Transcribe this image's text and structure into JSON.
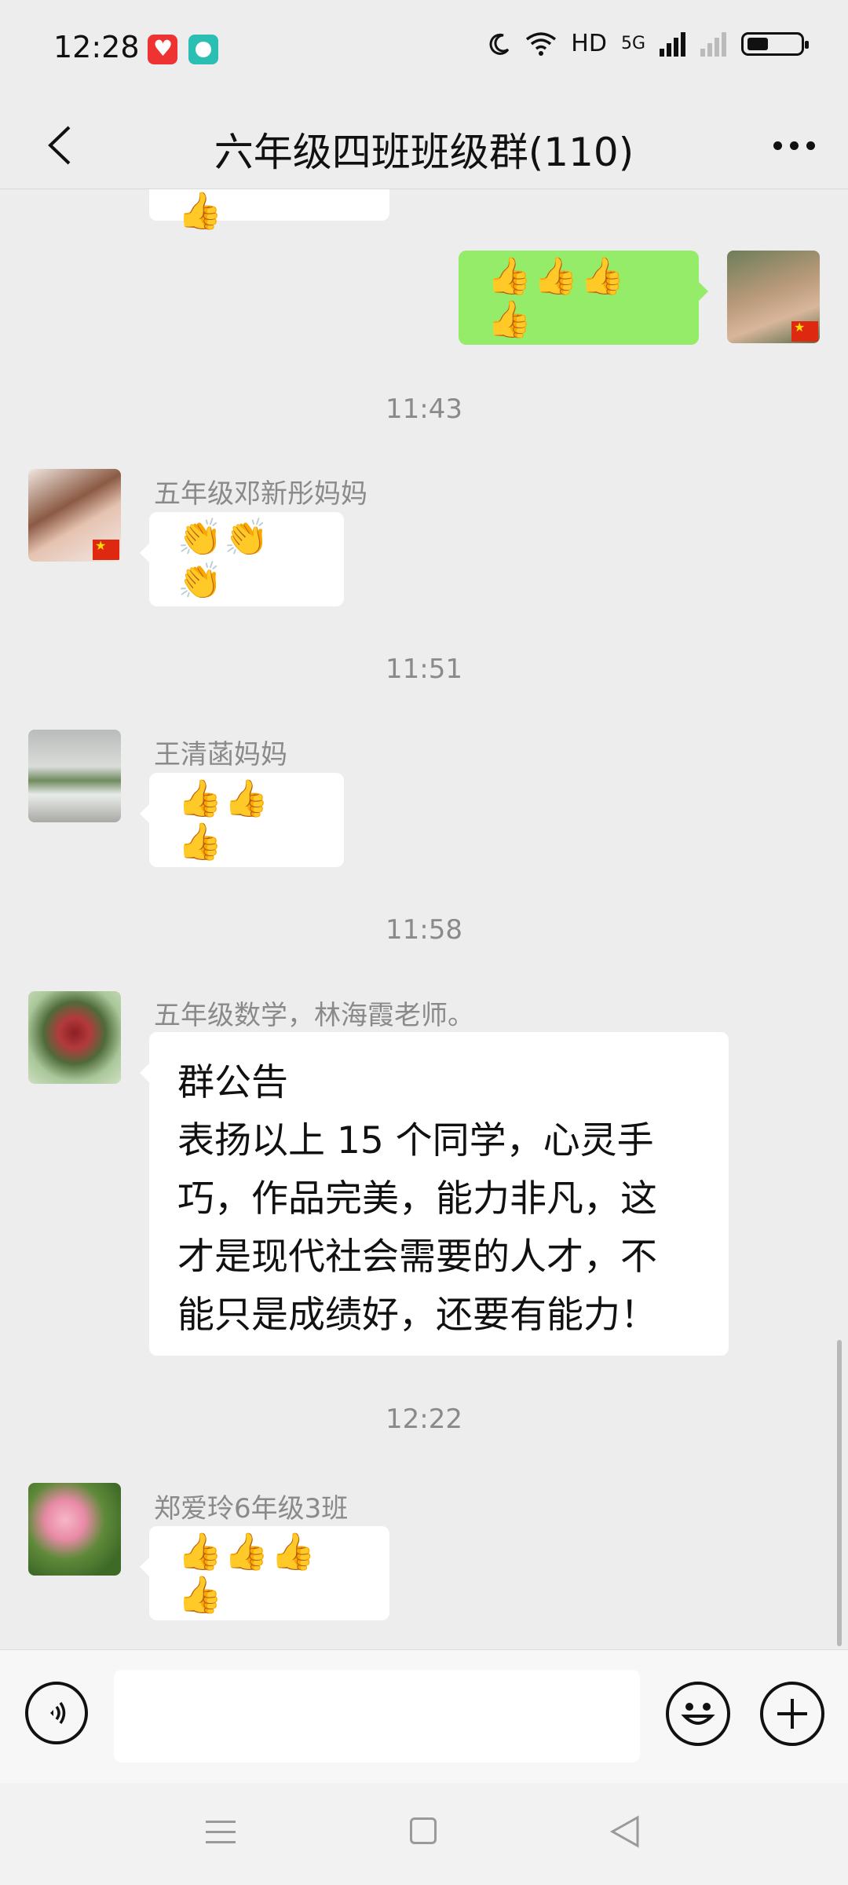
{
  "status_bar": {
    "time": "12:28",
    "network": "HD",
    "signal": "5G",
    "icons": [
      "moon-icon",
      "wifi-icon",
      "signal-icon",
      "battery-icon"
    ]
  },
  "header": {
    "title": "六年级四班班级群(110)"
  },
  "messages": [
    {
      "id": "partial",
      "sender": "",
      "content": "👍👍👍👍",
      "mine": false
    },
    {
      "id": "self-1",
      "content": "👍👍👍👍",
      "mine": true
    },
    {
      "id": "ts-1",
      "timestamp": "11:43"
    },
    {
      "id": "msg-1",
      "sender": "五年级邓新彤妈妈",
      "content": "👏👏👏"
    },
    {
      "id": "ts-2",
      "timestamp": "11:51"
    },
    {
      "id": "msg-2",
      "sender": "王清菡妈妈",
      "content": "👍👍👍"
    },
    {
      "id": "ts-3",
      "timestamp": "11:58"
    },
    {
      "id": "msg-3",
      "sender": "五年级数学，林海霞老师。",
      "lines": [
        "群公告",
        "表扬以上 15 个同学，心灵手",
        "巧，作品完美，能力非凡，这",
        "才是现代社会需要的人才，不",
        "能只是成绩好，还要有能力！"
      ]
    },
    {
      "id": "ts-4",
      "timestamp": "12:22"
    },
    {
      "id": "msg-4",
      "sender": "郑爱玲6年级3班",
      "content": "👍👍👍👍"
    }
  ],
  "input_bar": {
    "placeholder": ""
  },
  "colors": {
    "background": "#ededed",
    "self_bubble": "#95ec69",
    "other_bubble": "#ffffff",
    "muted_text": "#8a8a8a"
  }
}
